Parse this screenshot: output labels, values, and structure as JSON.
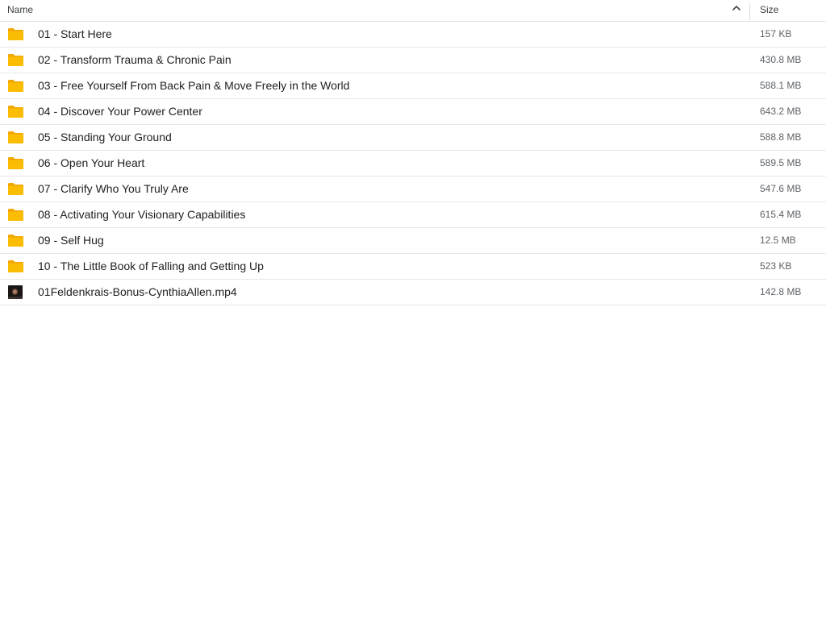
{
  "header": {
    "name_label": "Name",
    "size_label": "Size",
    "sort_icon": "chevron-up-icon"
  },
  "files": [
    {
      "type": "folder",
      "name": "01 - Start Here",
      "size": "157 KB"
    },
    {
      "type": "folder",
      "name": "02 - Transform Trauma & Chronic Pain",
      "size": "430.8 MB"
    },
    {
      "type": "folder",
      "name": "03 - Free Yourself From Back Pain & Move Freely in the World",
      "size": "588.1 MB"
    },
    {
      "type": "folder",
      "name": "04 - Discover Your Power Center",
      "size": "643.2 MB"
    },
    {
      "type": "folder",
      "name": "05 - Standing Your Ground",
      "size": "588.8 MB"
    },
    {
      "type": "folder",
      "name": "06 - Open Your Heart",
      "size": "589.5 MB"
    },
    {
      "type": "folder",
      "name": "07 - Clarify Who You Truly Are",
      "size": "547.6 MB"
    },
    {
      "type": "folder",
      "name": "08 - Activating Your Visionary Capabilities",
      "size": "615.4 MB"
    },
    {
      "type": "folder",
      "name": "09 - Self Hug",
      "size": "12.5 MB"
    },
    {
      "type": "folder",
      "name": "10 - The Little Book of Falling and Getting Up",
      "size": "523 KB"
    },
    {
      "type": "video",
      "name": "01Feldenkrais-Bonus-CynthiaAllen.mp4",
      "size": "142.8 MB"
    }
  ],
  "colors": {
    "folder": "#fbbc04",
    "folder_dark": "#f2a600",
    "divider": "#e8e8e8"
  }
}
